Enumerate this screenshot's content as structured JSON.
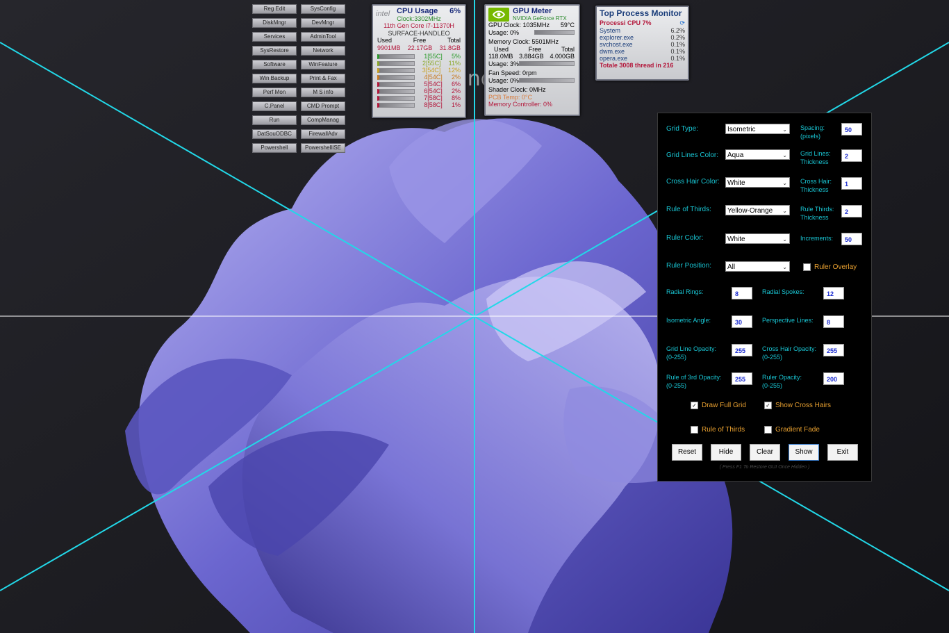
{
  "shortcuts": [
    [
      "Reg Edit",
      "SysConfig"
    ],
    [
      "DiskMngr",
      "DevMngr"
    ],
    [
      "Services",
      "AdminTool"
    ],
    [
      "SysRestore",
      "Network"
    ],
    [
      "Software",
      "WinFeature"
    ],
    [
      "Win Backup",
      "Print & Fax"
    ],
    [
      "Perf Mon",
      "M S info"
    ],
    [
      "C.Panel",
      "CMD Prompt"
    ],
    [
      "Run",
      "CompManag"
    ],
    [
      "DatSouODBC",
      "FirewallAdv"
    ],
    [
      "Powershell",
      "PowershellISE"
    ]
  ],
  "cpu": {
    "title": "CPU Usage",
    "usage": "6%",
    "clock": "Clock:3302MHz",
    "model": "11th Gen Core i7-11370H",
    "host": "SURFACE-HANDLEO",
    "col_used": "Used",
    "col_free": "Free",
    "col_total": "Total",
    "used": "9901MB",
    "free": "22.17GB",
    "total": "31.8GB",
    "cores": [
      {
        "label": "1[55C]",
        "pct": "5%"
      },
      {
        "label": "2[55C]",
        "pct": "11%"
      },
      {
        "label": "3[54C]",
        "pct": "12%"
      },
      {
        "label": "4[54C]",
        "pct": "2%"
      },
      {
        "label": "5[54C]",
        "pct": "6%"
      },
      {
        "label": "6[54C]",
        "pct": "2%"
      },
      {
        "label": "7[58C]",
        "pct": "8%"
      },
      {
        "label": "8[58C]",
        "pct": "1%"
      }
    ],
    "watermark": "intel"
  },
  "gpu": {
    "title": "GPU Meter",
    "model": "NVIDIA GeForce RTX",
    "clock": "GPU Clock: 1035MHz",
    "temp": "59°C",
    "usage": "Usage: 0%",
    "mem_clock": "Memory Clock: 5501MHz",
    "col_used": "Used",
    "col_free": "Free",
    "col_total": "Total",
    "used": "118.0MB",
    "free": "3.884GB",
    "total": "4.000GB",
    "mem_usage": "Usage: 3%",
    "fan": "Fan Speed: 0rpm",
    "fan_usage": "Usage: 0%",
    "shader": "Shader Clock: 0MHz",
    "pcb": "PCB Temp: 0°C",
    "mem_ctrl": "Memory Controller: 0%"
  },
  "top_process": {
    "title": "Top Process Monitor",
    "header": "Processi CPU 7%",
    "rows": [
      {
        "name": "System",
        "pct": "6.2%"
      },
      {
        "name": "explorer.exe",
        "pct": "0.2%"
      },
      {
        "name": "svchost.exe",
        "pct": "0.1%"
      },
      {
        "name": "dwm.exe",
        "pct": "0.1%"
      },
      {
        "name": "opera.exe",
        "pct": "0.1%"
      }
    ],
    "total": "Totale 3008 thread in 216"
  },
  "desktop_text": "landlo",
  "panel": {
    "grid_type_label": "Grid Type:",
    "grid_type": "Isometric",
    "spacing_label_1": "Spacing:",
    "spacing_label_2": "(pixels)",
    "spacing": "50",
    "grid_color_label": "Grid Lines Color:",
    "grid_color": "Aqua",
    "grid_thick_label_1": "Grid Lines:",
    "grid_thick_label_2": "Thickness",
    "grid_thick": "2",
    "crosshair_color_label": "Cross Hair Color:",
    "crosshair_color": "White",
    "crosshair_thick_label_1": "Cross Hair:",
    "crosshair_thick_label_2": "Thickness",
    "crosshair_thick": "1",
    "thirds_label": "Rule of Thirds:",
    "thirds_color": "Yellow-Orange",
    "thirds_thick_label_1": "Rule Thirds:",
    "thirds_thick_label_2": "Thickness",
    "thirds_thick": "2",
    "ruler_color_label": "Ruler Color:",
    "ruler_color": "White",
    "increments_label": "Increments:",
    "increments": "50",
    "ruler_pos_label": "Ruler Position:",
    "ruler_pos": "All",
    "ruler_overlay_label": "Ruler Overlay",
    "rings_label": "Radial Rings:",
    "rings": "8",
    "spokes_label": "Radial Spokes:",
    "spokes": "12",
    "iso_angle_label": "Isometric Angle:",
    "iso_angle": "30",
    "persp_label": "Perspective Lines:",
    "persp": "8",
    "grid_opacity_label_1": "Grid Line Opacity:",
    "grid_opacity_label_2": "(0-255)",
    "grid_opacity": "255",
    "crosshair_opacity_label_1": "Cross Hair Opacity:",
    "crosshair_opacity_label_2": "(0-255)",
    "crosshair_opacity": "255",
    "thirds_opacity_label_1": "Rule of 3rd Opacity:",
    "thirds_opacity_label_2": "(0-255)",
    "thirds_opacity": "255",
    "ruler_opacity_label_1": "Ruler Opacity:",
    "ruler_opacity_label_2": "(0-255)",
    "ruler_opacity": "200",
    "draw_full_grid": "Draw Full Grid",
    "show_cross_hairs": "Show Cross Hairs",
    "rule_of_thirds": "Rule of Thirds",
    "gradient_fade": "Gradient Fade",
    "buttons": [
      "Reset",
      "Hide",
      "Clear",
      "Show",
      "Exit"
    ],
    "note": "( Press F1 To Restore GUI Once Hidden )"
  },
  "colors": {
    "grid": "#22d8e8",
    "crosshair": "#ffffff",
    "label": "#19c6d4",
    "check_label": "#e8a030",
    "petal": "#6f6bd0"
  }
}
